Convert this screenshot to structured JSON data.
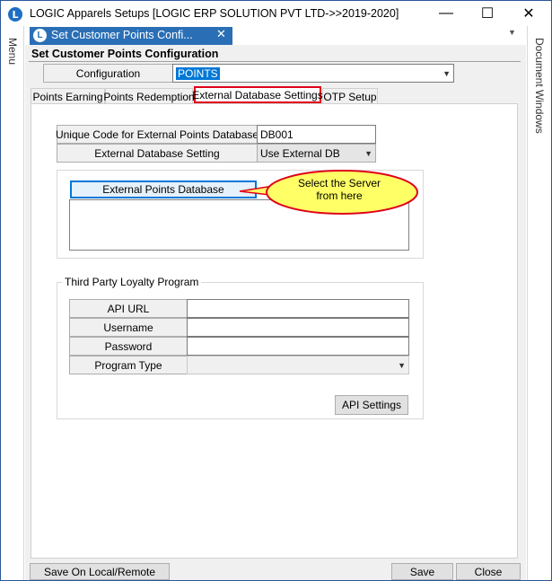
{
  "window": {
    "app_icon_letter": "L",
    "title": "LOGIC Apparels Setups  [LOGIC ERP SOLUTION PVT LTD->>2019-2020]",
    "minimize": "—",
    "maximize": "☐",
    "close": "✕"
  },
  "side_panels": {
    "left": "Menu",
    "right": "Document Windows"
  },
  "doc_tab": {
    "icon_letter": "L",
    "label": "Set Customer Points Confi...",
    "close": "✕"
  },
  "form": {
    "title": "Set Customer Points Configuration",
    "configuration_label": "Configuration",
    "configuration_value": "POINTS"
  },
  "tabs": [
    {
      "label": "Points Earning",
      "active": false
    },
    {
      "label": "Points Redemption",
      "active": false
    },
    {
      "label": "External Database Settings",
      "active": true
    },
    {
      "label": "OTP Setup",
      "active": false
    }
  ],
  "external_db": {
    "unique_code_label": "Unique Code for External Points Database",
    "unique_code_value": "DB001",
    "setting_label": "External Database Setting",
    "setting_value": "Use External DB",
    "points_db_button": "External Points Database"
  },
  "callout": {
    "text": "Select  the  Server\nfrom  here",
    "fill_color": "#ffff66",
    "border_color": "#e0001b"
  },
  "third_party": {
    "legend": "Third Party Loyalty Program",
    "api_url_label": "API URL",
    "api_url_value": "",
    "username_label": "Username",
    "username_value": "",
    "password_label": "Password",
    "password_value": "",
    "program_type_label": "Program Type",
    "program_type_value": "",
    "api_settings_button": "API Settings"
  },
  "footer": {
    "save_local_remote": "Save On Local/Remote",
    "save": "Save",
    "close": "Close"
  },
  "colors": {
    "active_tab_border": "#e0001b",
    "doc_tab_bg": "#2a6fb6",
    "selection": "#0078d7"
  }
}
